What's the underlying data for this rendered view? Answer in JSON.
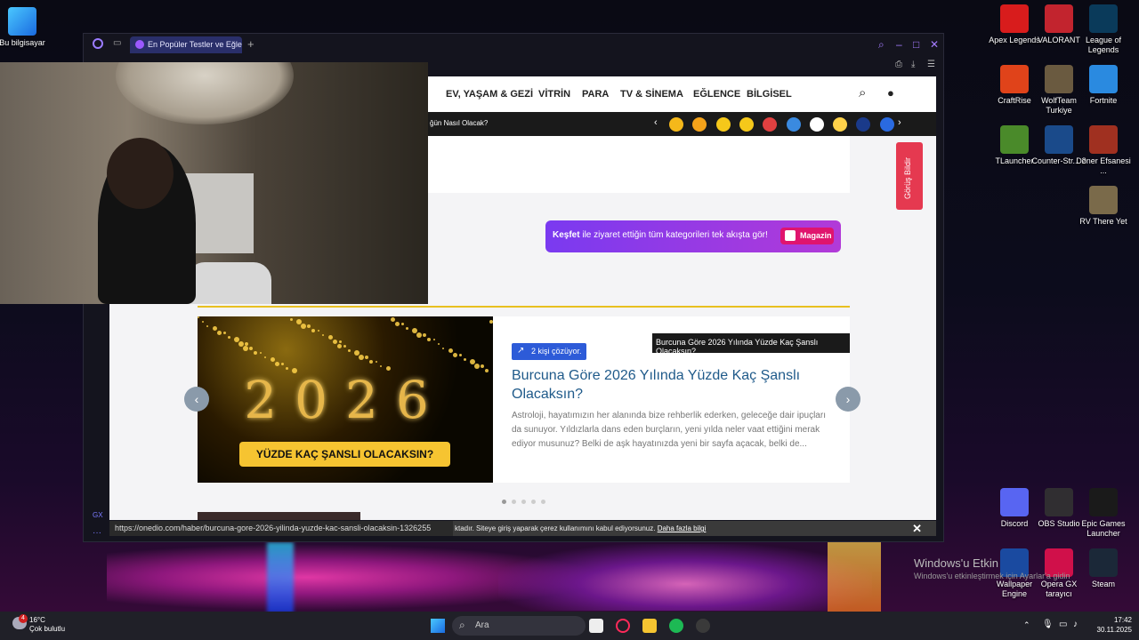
{
  "desktop": {
    "left_icons": [
      {
        "label": "Bu bilgisayar"
      }
    ],
    "right_icons": [
      {
        "label": "Apex Legends",
        "color": "#d81c1c"
      },
      {
        "label": "VALORANT",
        "color": "#c2242e"
      },
      {
        "label": "League of Legends",
        "color": "#0a3a5a"
      },
      {
        "label": "CraftRise",
        "color": "#e0431a"
      },
      {
        "label": "WolfTeam Turkiye",
        "color": "#6a5a40"
      },
      {
        "label": "Fortnite",
        "color": "#2a8ae0"
      },
      {
        "label": "TLauncher",
        "color": "#4a8a2a"
      },
      {
        "label": "Counter-Str... 2",
        "color": "#1a4a8a"
      },
      {
        "label": "Döner Efsanesi ...",
        "color": "#a03020"
      },
      {
        "label": "RV There Yet",
        "color": "#7a6a4a"
      },
      {
        "label": "Discord",
        "color": "#5865f2"
      },
      {
        "label": "OBS Studio",
        "color": "#302e31"
      },
      {
        "label": "Epic Games Launcher",
        "color": "#1a1a1a"
      },
      {
        "label": "Wallpaper Engine",
        "color": "#1a4aa0"
      },
      {
        "label": "Opera GX tarayıcı",
        "color": "#d0104a"
      },
      {
        "label": "Steam",
        "color": "#1b2838"
      }
    ],
    "watermark_line1": "Windows'u Etkin",
    "watermark_line2": "Windows'u etkinleştirmek için Ayarlar'a gidin"
  },
  "browser": {
    "tab_title": "En Popüler Testler ve Eğle",
    "status_url": "https://onedio.com/haber/burcuna-gore-2026-yilinda-yuzde-kac-sansli-olacaksin-1326255",
    "left_gx_label": "GX"
  },
  "site": {
    "nav": [
      "EV, YAŞAM & GEZİ",
      "VİTRİN",
      "PARA",
      "TV & SİNEMA",
      "EĞLENCE",
      "BİLGİSEL"
    ],
    "ticker_text": "ğün Nasıl Olacak?",
    "discover": {
      "bold": "Keşfet",
      "text": " ile ziyaret ettiğin tüm kategorileri tek akışta gör!",
      "button": "Magazin"
    },
    "feedback_label": "Görüş Bildir",
    "slide": {
      "image_year": "2026",
      "image_tagline": "YÜZDE KAÇ ŞANSLI OLACAKSIN?",
      "badge": "2 kişi çözüyor.",
      "title": "Burcuna Göre 2026 Yılında Yüzde Kaç Şanslı Olacaksın?",
      "description": "Astroloji, hayatımızın her alanında bize rehberlik ederken, geleceğe dair ipuçları da sunuyor. Yıldızlarla dans eden burçların, yeni yılda neler vaat ettiğini merak ediyor musunuz? Belki de aşk hayatınızda yeni bir sayfa açacak, belki de...",
      "tooltip": "Burcuna Göre 2026 Yılında Yüzde Kaç Şanslı Olacaksın?"
    },
    "cookie": {
      "text": "ktadır. Siteye giriş yaparak çerez kullanımını kabul ediyorsunuz.",
      "link": "Daha fazla bilgi"
    },
    "emoji_colors": [
      "#f5b81a",
      "#f5a31a",
      "#f5c81a",
      "#f5c81a",
      "#e04040",
      "#3a8ae0",
      "#ffffff",
      "#ffd24a",
      "#1a3a8a",
      "#2a6ae0"
    ]
  },
  "taskbar": {
    "weather_temp": "16°C",
    "weather_text": "Çok bulutlu",
    "weather_badge": "4",
    "search_placeholder": "Ara",
    "time": "17:42",
    "date": "30.11.2025"
  }
}
